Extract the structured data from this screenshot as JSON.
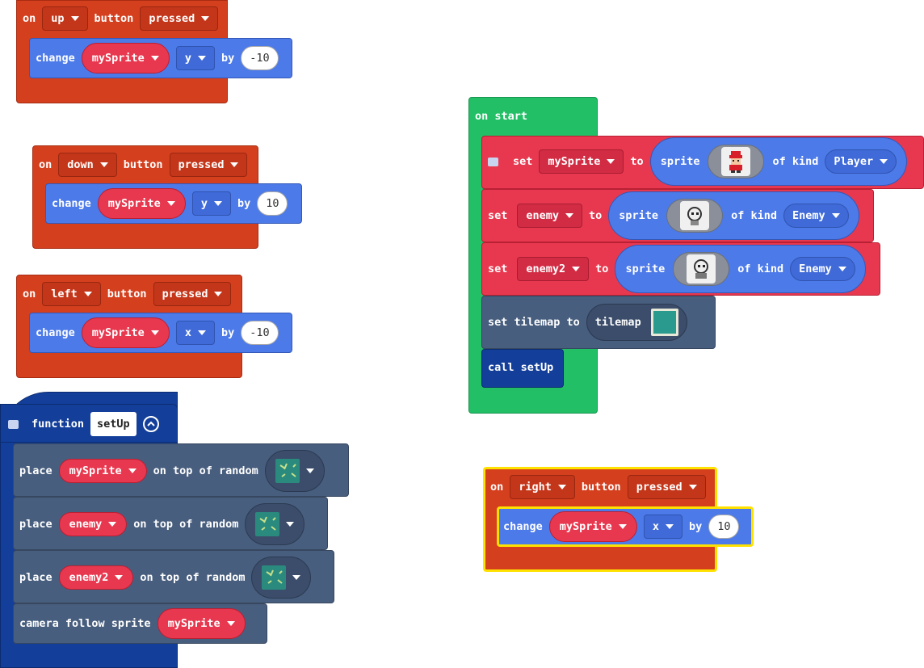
{
  "up_block": {
    "on": "on",
    "key": "up",
    "button": "button",
    "state": "pressed",
    "change": "change",
    "sprite": "mySprite",
    "axis": "y",
    "by": "by",
    "value": "-10"
  },
  "down_block": {
    "on": "on",
    "key": "down",
    "button": "button",
    "state": "pressed",
    "change": "change",
    "sprite": "mySprite",
    "axis": "y",
    "by": "by",
    "value": "10"
  },
  "left_block": {
    "on": "on",
    "key": "left",
    "button": "button",
    "state": "pressed",
    "change": "change",
    "sprite": "mySprite",
    "axis": "x",
    "by": "by",
    "value": "-10"
  },
  "right_block": {
    "on": "on",
    "key": "right",
    "button": "button",
    "state": "pressed",
    "change": "change",
    "sprite": "mySprite",
    "axis": "x",
    "by": "by",
    "value": "10"
  },
  "function_block": {
    "keyword": "function",
    "name": "setUp",
    "rows": [
      {
        "verb": "place",
        "sprite": "mySprite",
        "rest": "on top of random"
      },
      {
        "verb": "place",
        "sprite": "enemy",
        "rest": "on top of random"
      },
      {
        "verb": "place",
        "sprite": "enemy2",
        "rest": "on top of random"
      }
    ],
    "camera": {
      "text": "camera follow sprite",
      "sprite": "mySprite"
    }
  },
  "start_block": {
    "title": "on start",
    "set1": {
      "set": "set",
      "var": "mySprite",
      "to": "to",
      "sprite": "sprite",
      "of_kind": "of kind",
      "kind": "Player"
    },
    "set2": {
      "set": "set",
      "var": "enemy",
      "to": "to",
      "sprite": "sprite",
      "of_kind": "of kind",
      "kind": "Enemy"
    },
    "set3": {
      "set": "set",
      "var": "enemy2",
      "to": "to",
      "sprite": "sprite",
      "of_kind": "of kind",
      "kind": "Enemy"
    },
    "tilemap": {
      "text": "set tilemap to",
      "pill": "tilemap"
    },
    "call": "call setUp"
  },
  "icons": [
    "caret-down-icon",
    "comment-icon",
    "collapse-icon",
    "sprite-player-image",
    "sprite-enemy-image",
    "tile-image"
  ],
  "colors": {
    "event": "#d43f1e",
    "sprite": "#4c7ae8",
    "var": "#e8384f",
    "scene": "#485e7e",
    "function": "#133f9a",
    "loops": "#22bf66",
    "highlight": "#ffe100"
  }
}
